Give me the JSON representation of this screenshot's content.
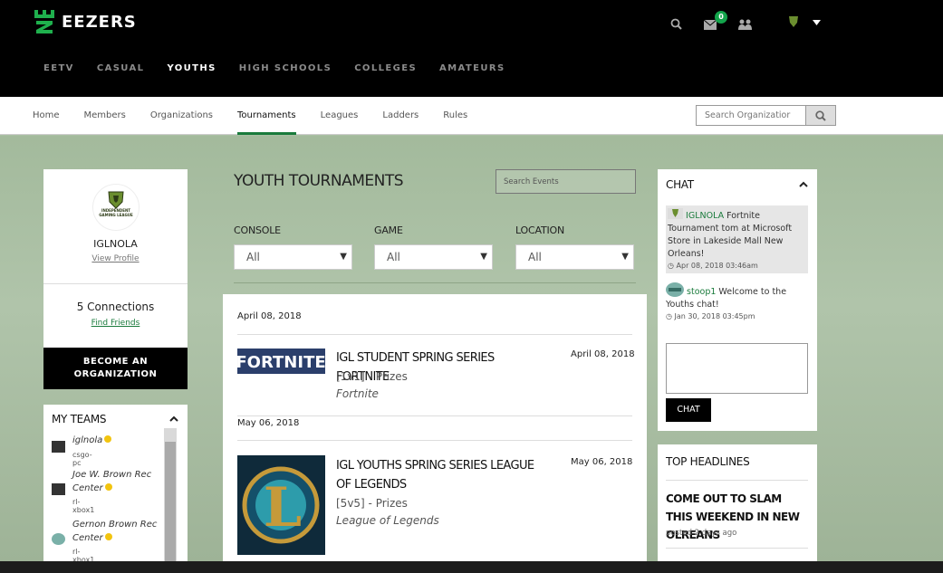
{
  "brand": {
    "name": "EEZERS"
  },
  "main_nav": [
    "EETV",
    "CASUAL",
    "YOUTHS",
    "HIGH SCHOOLS",
    "COLLEGES",
    "AMATEURS"
  ],
  "main_nav_active": "YOUTHS",
  "notifications": {
    "mail_count": "0"
  },
  "sub_nav": [
    "Home",
    "Members",
    "Organizations",
    "Tournaments",
    "Leagues",
    "Ladders",
    "Rules"
  ],
  "sub_nav_active": "Tournaments",
  "org_search": {
    "placeholder": "Search Organizatior"
  },
  "profile": {
    "name": "IGLNOLA",
    "link": "View Profile",
    "logo_text": "INDEPENDENT GAMING LEAGUE"
  },
  "connections": {
    "count_label": "5 Connections",
    "link": "Find Friends"
  },
  "become_org": {
    "line1": "BECOME AN",
    "line2": "ORGANIZATION"
  },
  "my_teams": {
    "title": "MY TEAMS",
    "teams": [
      {
        "name": "iglnola",
        "platform": "csgo-pc"
      },
      {
        "name": "Joe W. Brown Rec Center",
        "platform": "rl-xbox1"
      },
      {
        "name": "Gernon Brown Rec Center",
        "platform": "rl-xbox1"
      }
    ]
  },
  "tournaments": {
    "title": "YOUTH TOURNAMENTS",
    "search_placeholder": "Search Events",
    "filters": [
      {
        "label": "CONSOLE",
        "value": "All"
      },
      {
        "label": "GAME",
        "value": "All"
      },
      {
        "label": "LOCATION",
        "value": "All"
      }
    ],
    "groups": [
      {
        "date": "April 08, 2018",
        "events": [
          {
            "title": "IGL STUDENT SPRING SERIES FORTNITE",
            "mode": "[1v1] - Prizes",
            "game": "Fortnite",
            "date": "April 08, 2018",
            "thumb_text": "FORTNITE"
          }
        ]
      },
      {
        "date": "May 06, 2018",
        "events": [
          {
            "title": "IGL YOUTHS SPRING SERIES LEAGUE OF LEGENDS",
            "mode": "[5v5] - Prizes",
            "game": "League of Legends",
            "date": "May 06, 2018",
            "thumb_text": "L"
          }
        ]
      }
    ]
  },
  "chat": {
    "title": "CHAT",
    "messages": [
      {
        "user": "IGLNOLA",
        "text": " Fortnite Tournament tom at Microsoft Store in Lakeside Mall New Orleans!",
        "time": "Apr 08, 2018 03:46am"
      },
      {
        "user": "stoop1",
        "text": " Welcome to the Youths chat!",
        "time": "Jan 30, 2018 03:45pm"
      }
    ],
    "button": "CHAT"
  },
  "headlines": {
    "title": "TOP HEADLINES",
    "items": [
      {
        "title": "COME OUT TO SLAM THIS WEEKEND IN NEW OLREANS",
        "posted": "posted 2 days ago"
      }
    ]
  },
  "colors": {
    "accent": "#1a7b3c",
    "badge": "#13a44b",
    "status": "#f2c40f"
  }
}
